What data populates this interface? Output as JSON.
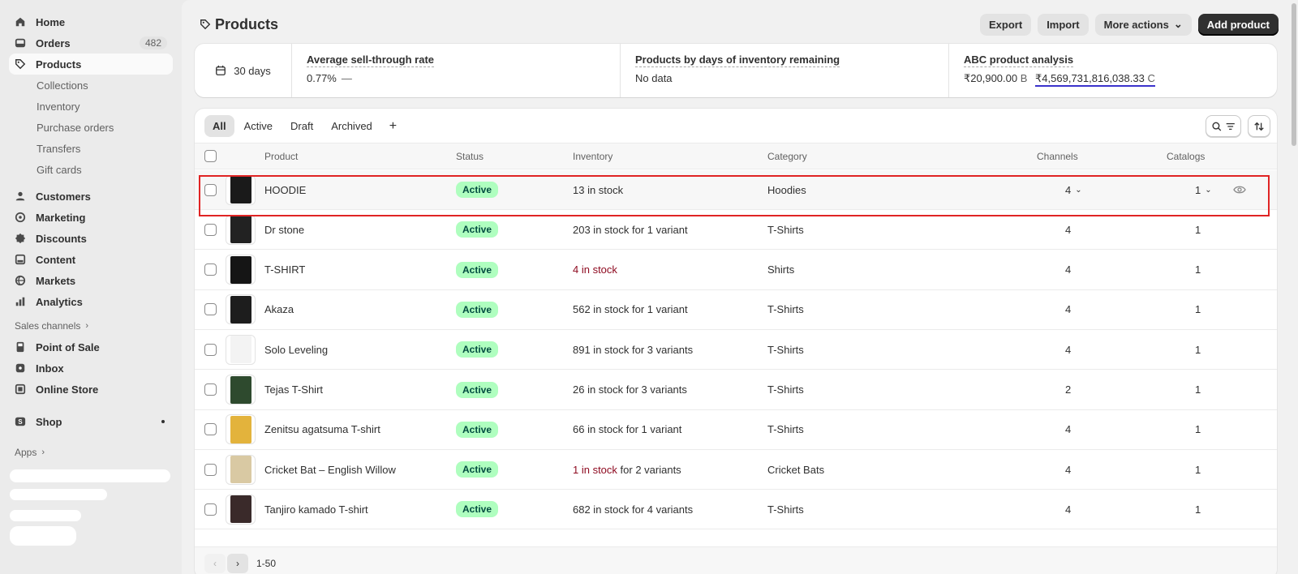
{
  "sidebar": {
    "items": [
      {
        "label": "Home",
        "icon": "home-icon"
      },
      {
        "label": "Orders",
        "icon": "orders-icon",
        "badge": "482"
      },
      {
        "label": "Products",
        "icon": "tag-icon",
        "selected": true
      }
    ],
    "product_subitems": [
      "Collections",
      "Inventory",
      "Purchase orders",
      "Transfers",
      "Gift cards"
    ],
    "items2": [
      {
        "label": "Customers",
        "icon": "person-icon"
      },
      {
        "label": "Marketing",
        "icon": "target-icon"
      },
      {
        "label": "Discounts",
        "icon": "discount-icon"
      },
      {
        "label": "Content",
        "icon": "content-icon"
      },
      {
        "label": "Markets",
        "icon": "globe-icon"
      },
      {
        "label": "Analytics",
        "icon": "chart-icon"
      }
    ],
    "sales_channels_label": "Sales channels",
    "channels": [
      {
        "label": "Point of Sale",
        "icon": "pos-icon"
      },
      {
        "label": "Inbox",
        "icon": "inbox-icon"
      },
      {
        "label": "Online Store",
        "icon": "store-icon"
      }
    ],
    "shop_label": "Shop",
    "apps_label": "Apps"
  },
  "header": {
    "title": "Products",
    "export_label": "Export",
    "import_label": "Import",
    "more_actions_label": "More actions",
    "add_product_label": "Add product"
  },
  "metrics": {
    "period": "30 days",
    "sell_through": {
      "title": "Average sell-through rate",
      "value": "0.77%",
      "dash": "—"
    },
    "days_inventory": {
      "title": "Products by days of inventory remaining",
      "value": "No data"
    },
    "abc": {
      "title": "ABC product analysis",
      "value_b": "₹20,900.00",
      "grade_b": "B",
      "value_c": "₹4,569,731,816,038.33",
      "grade_c": "C"
    }
  },
  "tabs": [
    "All",
    "Active",
    "Draft",
    "Archived"
  ],
  "columns": {
    "product": "Product",
    "status": "Status",
    "inventory": "Inventory",
    "category": "Category",
    "channels": "Channels",
    "catalogs": "Catalogs"
  },
  "rows": [
    {
      "name": "HOODIE",
      "status": "Active",
      "inventory_warn": "",
      "inventory": "13 in stock",
      "category": "Hoodies",
      "channels": "4",
      "catalogs": "1",
      "thumb_color": "#1a1a1a"
    },
    {
      "name": "Dr stone",
      "status": "Active",
      "inventory_warn": "",
      "inventory": "203 in stock for 1 variant",
      "category": "T-Shirts",
      "channels": "4",
      "catalogs": "1",
      "thumb_color": "#222222"
    },
    {
      "name": "T-SHIRT",
      "status": "Active",
      "inventory_warn": "4 in stock",
      "inventory": "",
      "category": "Shirts",
      "channels": "4",
      "catalogs": "1",
      "thumb_color": "#151515"
    },
    {
      "name": "Akaza",
      "status": "Active",
      "inventory_warn": "",
      "inventory": "562 in stock for 1 variant",
      "category": "T-Shirts",
      "channels": "4",
      "catalogs": "1",
      "thumb_color": "#1d1d1d"
    },
    {
      "name": "Solo Leveling",
      "status": "Active",
      "inventory_warn": "",
      "inventory": "891 in stock for 3 variants",
      "category": "T-Shirts",
      "channels": "4",
      "catalogs": "1",
      "thumb_color": "#f3f3f3"
    },
    {
      "name": "Tejas T-Shirt",
      "status": "Active",
      "inventory_warn": "",
      "inventory": "26 in stock for 3 variants",
      "category": "T-Shirts",
      "channels": "2",
      "catalogs": "1",
      "thumb_color": "#2e4a2e"
    },
    {
      "name": "Zenitsu agatsuma T-shirt",
      "status": "Active",
      "inventory_warn": "",
      "inventory": "66 in stock for 1 variant",
      "category": "T-Shirts",
      "channels": "4",
      "catalogs": "1",
      "thumb_color": "#e3b33c"
    },
    {
      "name": "Cricket Bat – English Willow",
      "status": "Active",
      "inventory_warn": "1 in stock",
      "inventory": " for 2 variants",
      "category": "Cricket Bats",
      "channels": "4",
      "catalogs": "1",
      "thumb_color": "#d9c9a3"
    },
    {
      "name": "Tanjiro kamado T-shirt",
      "status": "Active",
      "inventory_warn": "",
      "inventory": "682 in stock for 4 variants",
      "category": "T-Shirts",
      "channels": "4",
      "catalogs": "1",
      "thumb_color": "#3a2a2a"
    }
  ],
  "pagination": {
    "range": "1-50",
    "prev": "‹",
    "next": "›"
  },
  "colors": {
    "accent": "#303030",
    "status_bg": "#affebf",
    "warn": "#8e0b21",
    "highlight": "#e02424"
  }
}
